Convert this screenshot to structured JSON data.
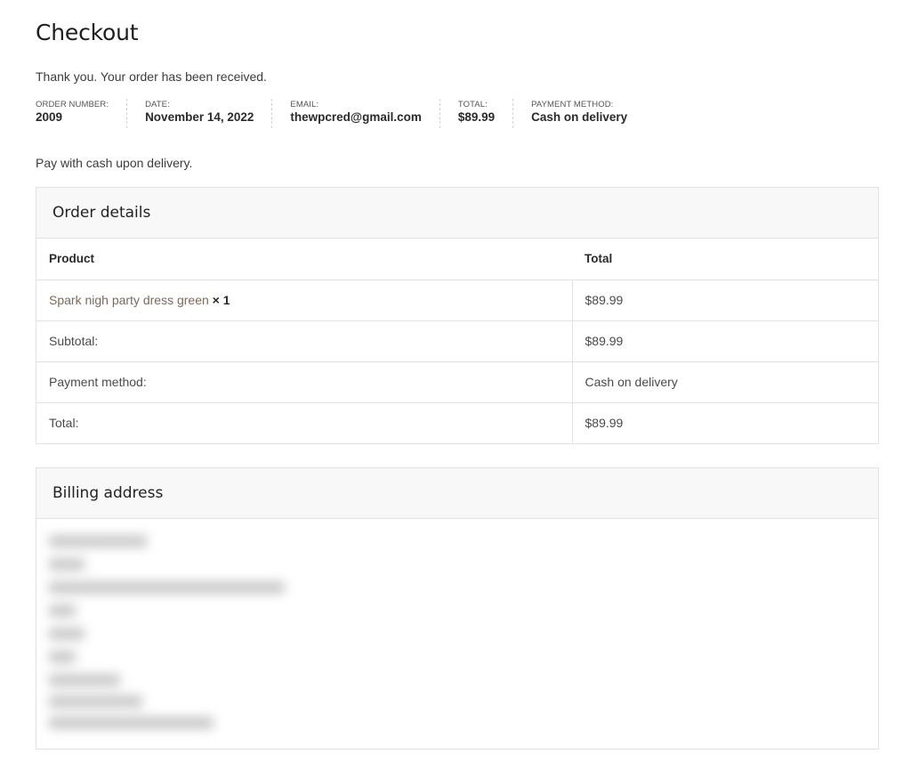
{
  "page": {
    "title": "Checkout",
    "thank_you": "Thank you. Your order has been received.",
    "payment_note": "Pay with cash upon delivery."
  },
  "overview": [
    {
      "label": "Order number:",
      "value": "2009"
    },
    {
      "label": "Date:",
      "value": "November 14, 2022"
    },
    {
      "label": "Email:",
      "value": "thewpcred@gmail.com"
    },
    {
      "label": "Total:",
      "value": "$89.99"
    },
    {
      "label": "Payment method:",
      "value": "Cash on delivery"
    }
  ],
  "order_details": {
    "heading": "Order details",
    "columns": {
      "product": "Product",
      "total": "Total"
    },
    "item": {
      "name": "Spark nigh party dress green",
      "quantity": "× 1",
      "total": "$89.99"
    },
    "rows": [
      {
        "label": "Subtotal:",
        "value": "$89.99"
      },
      {
        "label": "Payment method:",
        "value": "Cash on delivery"
      },
      {
        "label": "Total:",
        "value": "$89.99"
      }
    ]
  },
  "billing": {
    "heading": "Billing address"
  },
  "colors": {
    "product_link": "#7a6a5a",
    "border": "#e2e2e2",
    "header_bg": "#f8f8f8"
  }
}
